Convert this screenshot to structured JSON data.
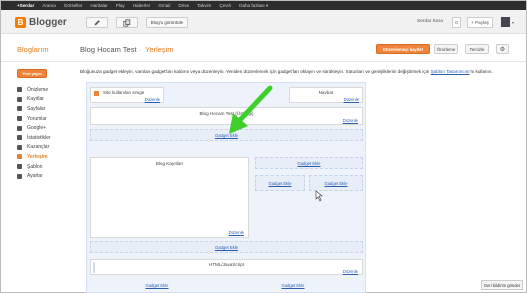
{
  "gbar": {
    "items": [
      "+Serdar",
      "Arama",
      "Görseller",
      "Haritalar",
      "Play",
      "Haberler",
      "Gmail",
      "Drive",
      "Takvim",
      "Çeviri",
      "Daha fazlası ▾"
    ]
  },
  "header": {
    "logo_text": "Blogger",
    "view_blog": "Blog'u görüntüle",
    "user_name": "Serdar Kara",
    "count": "0",
    "share": "+ Paylaş",
    "avatar_caret": "▾"
  },
  "page": {
    "section_title": "Bloglarım",
    "blog_name": "Blog Hocam Test",
    "separator": "·",
    "current_page": "Yerleşim",
    "save_button": "Düzenlemeyi kaydet",
    "preview_button": "Önizleme",
    "clear_button": "Temizle"
  },
  "sidebar": {
    "new_post": "Yeni yayın",
    "items": [
      {
        "label": "Önizleme"
      },
      {
        "label": "Kayıtlar"
      },
      {
        "label": "Sayfalar"
      },
      {
        "label": "Yorumlar"
      },
      {
        "label": "Google+"
      },
      {
        "label": "İstatistikler"
      },
      {
        "label": "Kazançlar"
      },
      {
        "label": "Yerleşim",
        "active": true
      },
      {
        "label": "Şablon"
      },
      {
        "label": "Ayarlar"
      }
    ]
  },
  "description": {
    "text": "Bloğunuza gadget ekleyin, varolan gadget'ları kaldırın veya düzenleyin. Yeniden düzenlemek için gadget'ları tıklayın ve sürükleyin. Sütunları ve genişliklerini değiştirmek için ",
    "link": "Şablon Tasarımcısı",
    "suffix": "'nı kullanın."
  },
  "layout": {
    "favicon_label": "Site kullanılan simge",
    "navbar_label": "Navbar",
    "header_label": "Blog Hocam Test (Üstbilgi)",
    "blog_posts_label": "Blog Kayıtları",
    "html_label": "HTML/JavaScript",
    "edit": "Düzenle",
    "add_gadget": "Gadget Ekle"
  },
  "feedback": "Geri bildirim gönder",
  "colors": {
    "accent": "#f0843a",
    "link": "#2a5db0",
    "arrow": "#3ecf2b"
  }
}
